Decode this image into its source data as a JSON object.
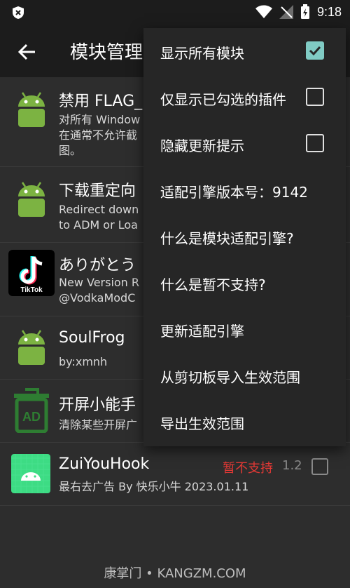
{
  "status": {
    "time": "9:18"
  },
  "appbar": {
    "title": "模块管理"
  },
  "modules": [
    {
      "title": "禁用 FLAG_",
      "desc": [
        "对所有 Window",
        "在通常不允许截",
        "图。"
      ]
    },
    {
      "title": "下载重定向",
      "desc": [
        "Redirect down",
        "to ADM or Loa"
      ]
    },
    {
      "title": "ありがとう",
      "desc": [
        "New Version R",
        "@VodkaModC"
      ],
      "icon_label": "TikTok"
    },
    {
      "title": "SoulFrog",
      "desc": [
        "by:xmnh"
      ]
    },
    {
      "title": "开屏小能手",
      "desc": [
        "清除某些开屏广"
      ],
      "icon_label": "AD"
    },
    {
      "title": "ZuiYouHook",
      "desc": [
        "最右去广告 By 快乐小牛 2023.01.11"
      ],
      "status": "暂不支持",
      "version": "1.2"
    }
  ],
  "menu": {
    "items": [
      {
        "label": "显示所有模块",
        "checkbox": true,
        "checked": true
      },
      {
        "label": "仅显示已勾选的插件",
        "checkbox": true,
        "checked": false
      },
      {
        "label": "隐藏更新提示",
        "checkbox": true,
        "checked": false
      },
      {
        "label": "适配引擎版本号：9142"
      },
      {
        "label": "什么是模块适配引擎?"
      },
      {
        "label": "什么是暂不支持?"
      },
      {
        "label": "更新适配引擎"
      },
      {
        "label": "从剪切板导入生效范围"
      },
      {
        "label": "导出生效范围"
      }
    ]
  },
  "footer": {
    "watermark": "康掌门 • KANGZM.COM"
  },
  "colors": {
    "background": "#2d2d2d",
    "appbar": "#1c1c1c",
    "menu": "#262626",
    "accent_check": "#80cbc4",
    "android_green": "#7cb342",
    "ad_green": "#2e7d32",
    "unsupported_red": "#e53935"
  }
}
